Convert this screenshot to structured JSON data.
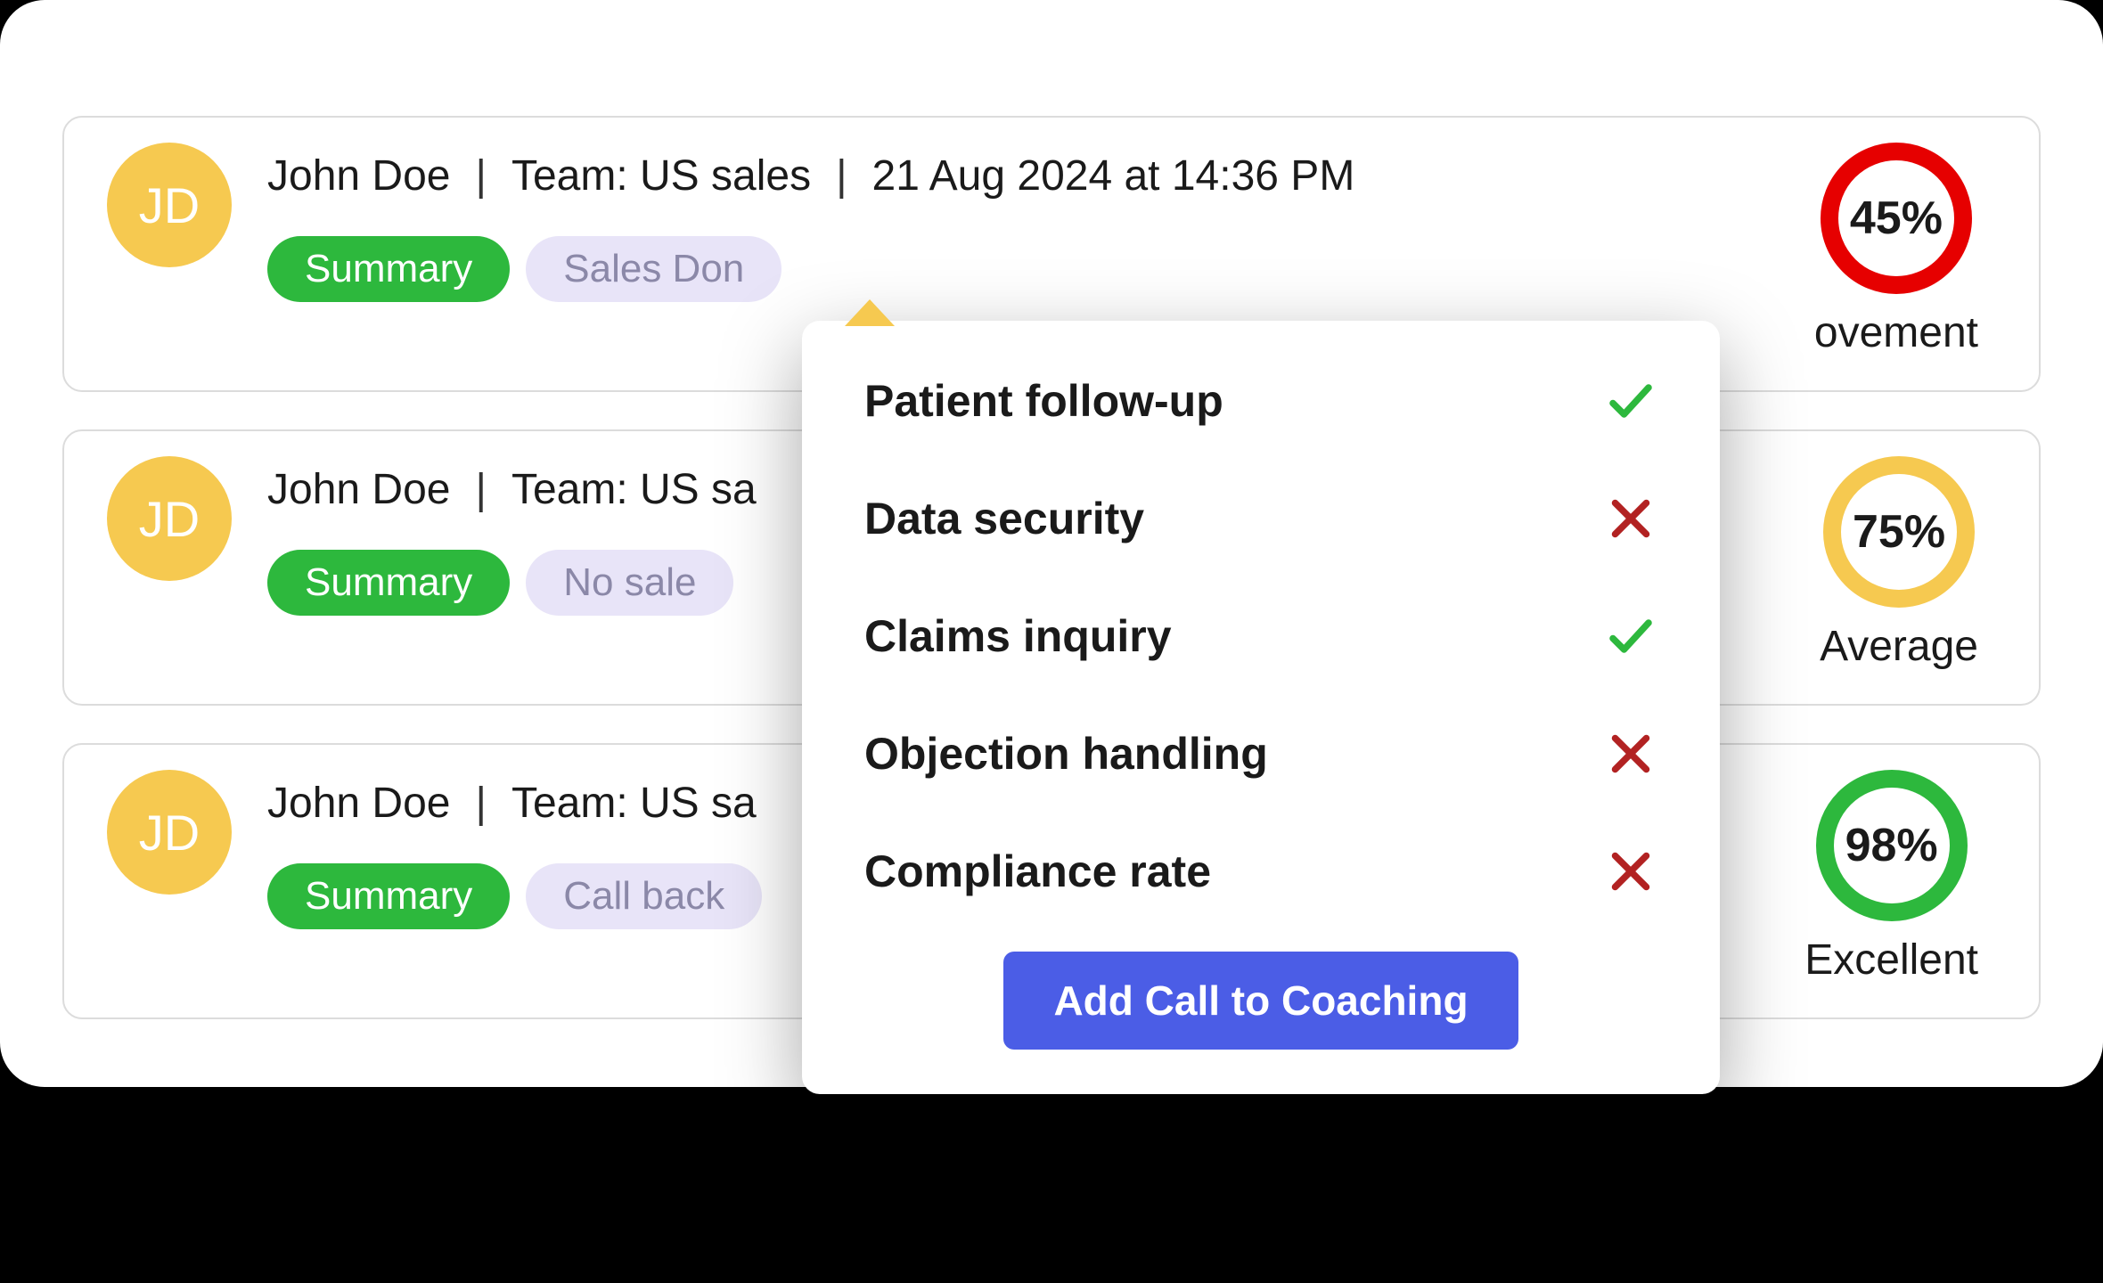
{
  "rows": [
    {
      "initials": "JD",
      "name": "John Doe",
      "team_label": "Team: US sales",
      "timestamp": "21 Aug 2024 at 14:36 PM",
      "summary_label": "Summary",
      "tag_label": "Sales Don",
      "score_pct": "45%",
      "score_label": "ovement",
      "ring_color": "red"
    },
    {
      "initials": "JD",
      "name": "John Doe",
      "team_label": "Team: US sales",
      "timestamp": "",
      "summary_label": "Summary",
      "tag_label": "No sale",
      "score_pct": "75%",
      "score_label": "Average",
      "ring_color": "amber"
    },
    {
      "initials": "JD",
      "name": "John Doe",
      "team_label": "Team: US sales",
      "timestamp": "",
      "summary_label": "Summary",
      "tag_label": "Call back",
      "score_pct": "98%",
      "score_label": "Excellent",
      "ring_color": "green"
    }
  ],
  "popover": {
    "items": [
      {
        "label": "Patient follow-up",
        "pass": true
      },
      {
        "label": "Data security",
        "pass": false
      },
      {
        "label": "Claims inquiry",
        "pass": true
      },
      {
        "label": "Objection handling",
        "pass": false
      },
      {
        "label": "Compliance rate",
        "pass": false
      }
    ],
    "button_label": "Add  Call to Coaching"
  }
}
